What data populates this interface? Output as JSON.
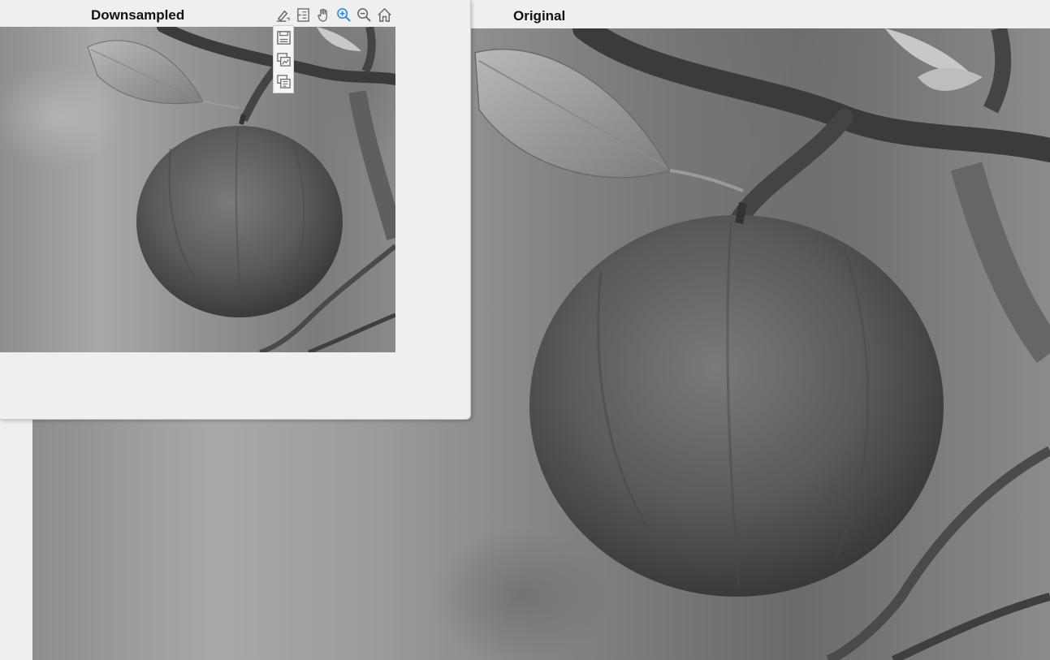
{
  "windows": {
    "original": {
      "title": "Original"
    },
    "downsampled": {
      "title": "Downsampled"
    }
  },
  "toolbar": {
    "items": [
      {
        "name": "brush-icon"
      },
      {
        "name": "datatip-icon"
      },
      {
        "name": "pan-hand-icon"
      },
      {
        "name": "zoom-in-icon",
        "active": true
      },
      {
        "name": "zoom-out-icon"
      },
      {
        "name": "home-icon"
      }
    ],
    "export_menu": [
      {
        "name": "save-icon"
      },
      {
        "name": "copy-image-icon"
      },
      {
        "name": "copy-vector-icon"
      }
    ]
  },
  "colors": {
    "window_bg": "#efefef",
    "icon_gray": "#666666",
    "icon_active": "#1e88e5"
  }
}
